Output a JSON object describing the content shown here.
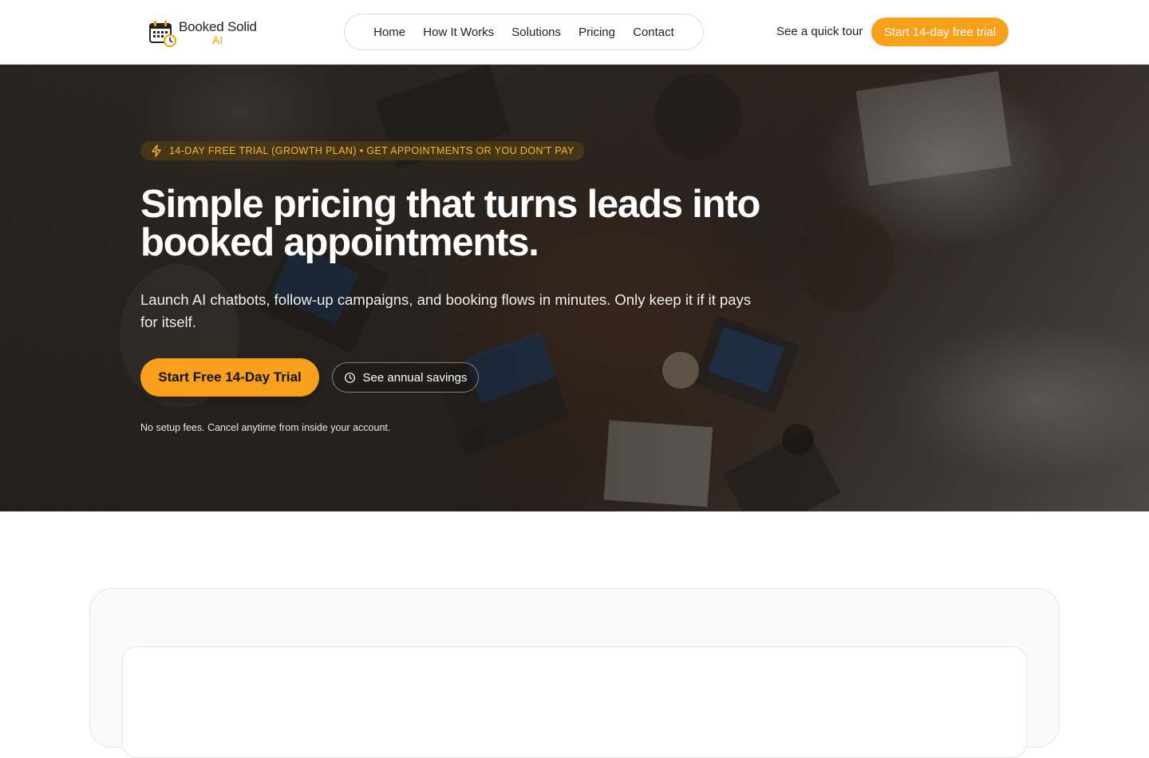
{
  "brand": {
    "name_line1": "Booked Solid",
    "name_line2": "AI",
    "accent_color": "#f9a01b"
  },
  "nav": {
    "items": [
      "Home",
      "How It Works",
      "Solutions",
      "Pricing",
      "Contact"
    ]
  },
  "header": {
    "tour_link": "See a quick tour",
    "trial_button": "Start 14-day free trial"
  },
  "hero": {
    "badge_icon": "lightning-icon",
    "badge": "14-DAY FREE TRIAL (GROWTH PLAN) • GET APPOINTMENTS OR YOU DON'T PAY",
    "title": "Simple pricing that turns leads into booked appointments.",
    "subtitle": "Launch AI chatbots, follow-up campaigns, and booking flows in minutes. Only keep it if it pays for itself.",
    "cta_primary": "Start Free 14-Day Trial",
    "cta_secondary_icon": "clock-icon",
    "cta_secondary": "See annual savings",
    "note": "No setup fees. Cancel anytime from inside your account."
  }
}
